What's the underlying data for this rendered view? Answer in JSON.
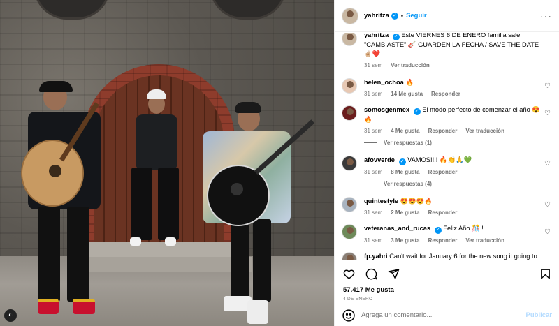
{
  "header": {
    "username": "yahritza",
    "follow_label": "Seguir",
    "more_label": "···"
  },
  "caption": {
    "username": "yahritza",
    "text": "Este VIERNES 6 DE ENERO familia sale \"CAMBIASTE\" 🎸 GUARDEN LA FECHA / SAVE THE DATE ✌🏼❤️",
    "time": "31 sem",
    "translate": "Ver traducción"
  },
  "comments": [
    {
      "username": "helen_ochoa",
      "text": "🔥",
      "time": "31 sem",
      "likes": "14 Me gusta",
      "reply": "Responder",
      "verified": false
    },
    {
      "username": "somosgenmex",
      "text": "El modo perfecto de comenzar el año 😍🔥",
      "time": "31 sem",
      "likes": "4 Me gusta",
      "reply": "Responder",
      "translate": "Ver traducción",
      "verified": true,
      "view_replies": "Ver respuestas (1)"
    },
    {
      "username": "afovverde",
      "text": "VAMOS!!!! 🔥👏🙏💚",
      "time": "31 sem",
      "likes": "8 Me gusta",
      "reply": "Responder",
      "verified": true,
      "view_replies": "Ver respuestas (4)"
    },
    {
      "username": "quintestyle",
      "text": "😍😍😍🔥",
      "time": "31 sem",
      "likes": "2 Me gusta",
      "reply": "Responder",
      "verified": false
    },
    {
      "username": "veteranas_and_rucas",
      "text": "Feliz Año 🎊 !",
      "time": "31 sem",
      "likes": "3 Me gusta",
      "reply": "Responder",
      "translate": "Ver traducción",
      "verified": true
    },
    {
      "username": "fp.yahri",
      "text": "Can't wait for January 6 for the new song it going to",
      "time": "",
      "likes": "",
      "reply": "",
      "verified": false
    }
  ],
  "stats": {
    "likes": "57.417 Me gusta",
    "date": "4 DE ENERO"
  },
  "composer": {
    "placeholder": "Agrega un comentario...",
    "publish": "Publicar"
  },
  "photo": {
    "corner_badge": "◐"
  },
  "colors": {
    "accent": "#0095f6",
    "publish_disabled": "#b3dbff",
    "muted": "#737373"
  },
  "icons": [
    "heart-icon",
    "comment-icon",
    "share-icon",
    "bookmark-icon",
    "emoji-icon",
    "more-icon",
    "verified-icon"
  ]
}
